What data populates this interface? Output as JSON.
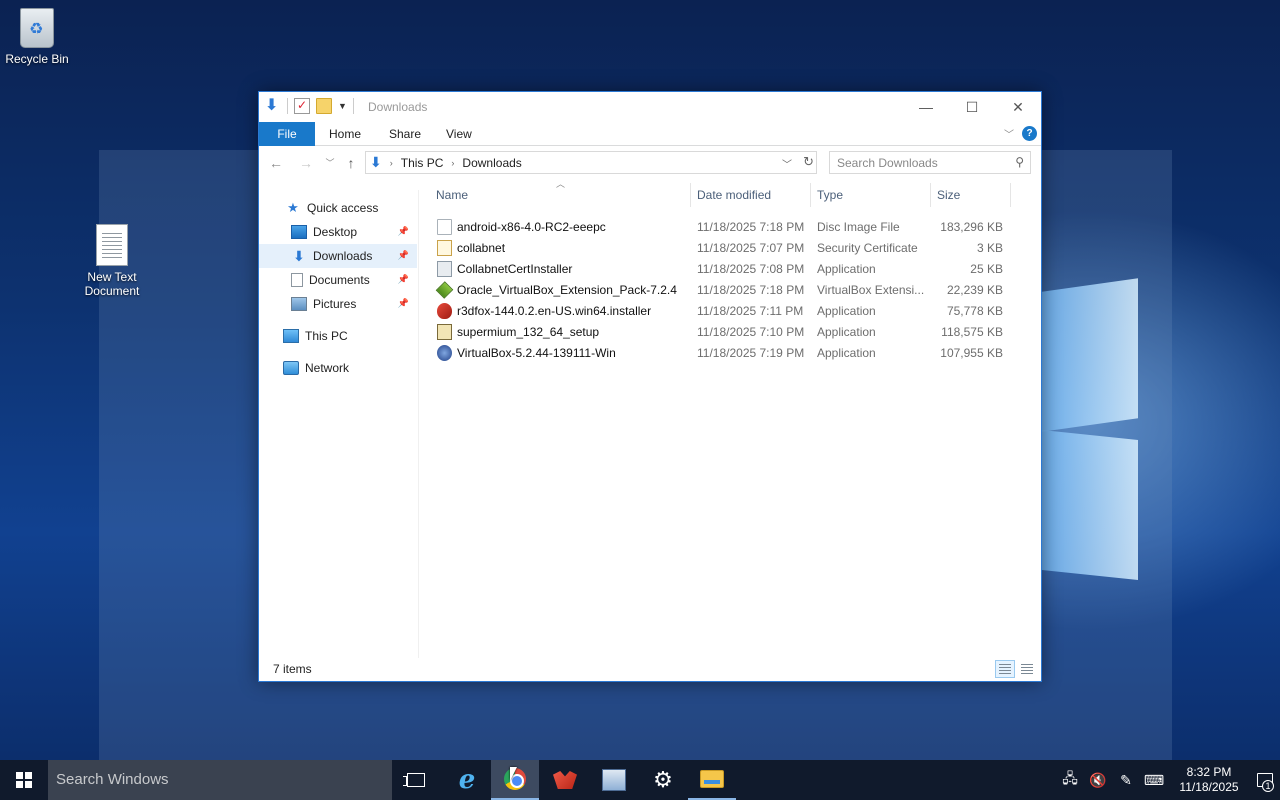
{
  "desktop": {
    "icons": [
      {
        "label": "Recycle Bin",
        "icon": "recycle-bin-icon"
      },
      {
        "label": "New Text\nDocument",
        "icon": "text-document-icon"
      }
    ]
  },
  "window": {
    "title": "Downloads",
    "controls": {
      "minimize": "—",
      "maximize": "☐",
      "close": "✕"
    },
    "ribbon_tabs": [
      "File",
      "Home",
      "Share",
      "View"
    ],
    "help": "?",
    "address": {
      "crumbs": [
        "This PC",
        "Downloads"
      ],
      "search_placeholder": "Search Downloads"
    },
    "nav_pane": {
      "quick_access": "Quick access",
      "items": [
        {
          "label": "Desktop",
          "pinned": true
        },
        {
          "label": "Downloads",
          "pinned": true,
          "selected": true
        },
        {
          "label": "Documents",
          "pinned": true
        },
        {
          "label": "Pictures",
          "pinned": true
        }
      ],
      "this_pc": "This PC",
      "network": "Network"
    },
    "columns": {
      "name": "Name",
      "date": "Date modified",
      "type": "Type",
      "size": "Size"
    },
    "files": [
      {
        "name": "android-x86-4.0-RC2-eeepc",
        "date": "11/18/2025 7:18 PM",
        "type": "Disc Image File",
        "size": "183,296 KB",
        "icon": "disc-image-icon"
      },
      {
        "name": "collabnet",
        "date": "11/18/2025 7:07 PM",
        "type": "Security Certificate",
        "size": "3 KB",
        "icon": "certificate-icon"
      },
      {
        "name": "CollabnetCertInstaller",
        "date": "11/18/2025 7:08 PM",
        "type": "Application",
        "size": "25 KB",
        "icon": "application-icon"
      },
      {
        "name": "Oracle_VirtualBox_Extension_Pack-7.2.4",
        "date": "11/18/2025 7:18 PM",
        "type": "VirtualBox Extensi...",
        "size": "22,239 KB",
        "icon": "virtualbox-extension-icon"
      },
      {
        "name": "r3dfox-144.0.2.en-US.win64.installer",
        "date": "11/18/2025 7:11 PM",
        "type": "Application",
        "size": "75,778 KB",
        "icon": "r3dfox-icon"
      },
      {
        "name": "supermium_132_64_setup",
        "date": "11/18/2025 7:10 PM",
        "type": "Application",
        "size": "118,575 KB",
        "icon": "setup-icon"
      },
      {
        "name": "VirtualBox-5.2.44-139111-Win",
        "date": "11/18/2025 7:19 PM",
        "type": "Application",
        "size": "107,955 KB",
        "icon": "virtualbox-icon"
      }
    ],
    "status": "7 items"
  },
  "taskbar": {
    "search_placeholder": "Search Windows",
    "clock_time": "8:32 PM",
    "clock_date": "11/18/2025",
    "notification_count": "1"
  }
}
